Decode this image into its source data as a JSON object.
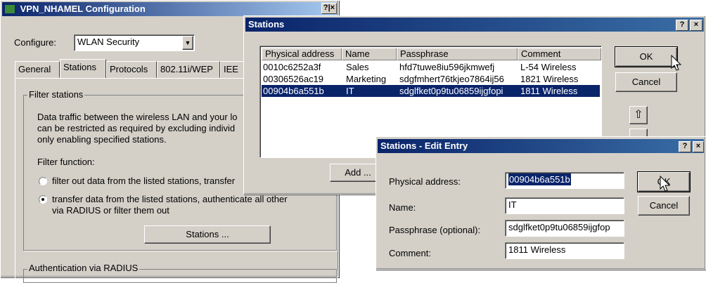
{
  "config_window": {
    "title": "VPN_NHAMEL Configuration",
    "help_close": "?|×",
    "configure_label": "Configure:",
    "configure_value": "WLAN Security",
    "tabs": [
      "General",
      "Stations",
      "Protocols",
      "802.11i/WEP",
      "IEE"
    ],
    "filter_group_title": "Filter stations",
    "filter_text_1": "Data traffic between the wireless LAN and your lo",
    "filter_text_2": "can be restricted as required by excluding individ",
    "filter_text_3": "only enabling specified stations.",
    "filter_function_label": "Filter function:",
    "radio_1_label": "filter out data from the listed stations, transfer",
    "radio_2_label_line1": "transfer data from the listed stations, authenticate all other",
    "radio_2_label_line2": "via RADIUS or filter them out",
    "stations_button": "Stations ...",
    "auth_group_title": "Authentication via RADIUS"
  },
  "stations_window": {
    "title": "Stations",
    "headers": [
      "Physical address",
      "Name",
      "Passphrase",
      "Comment"
    ],
    "rows": [
      [
        "0010c6252a3f",
        "Sales",
        "hfd7tuwe8iu596jkmwefj",
        "L-54 Wireless"
      ],
      [
        "00306526ac19",
        "Marketing",
        "sdgfmhert76tkjeo7864ij56",
        "1821 Wireless"
      ],
      [
        "00904b6a551b",
        "IT",
        "sdglfket0p9tu06859ijgfopi",
        "1811 Wireless"
      ]
    ],
    "selected_row": 2,
    "ok": "OK",
    "cancel": "Cancel",
    "add": "Add ...",
    "up_arrow": "⇧"
  },
  "edit_window": {
    "title": "Stations - Edit Entry",
    "physical_address_label": "Physical address:",
    "physical_address_value": "00904b6a551b",
    "name_label": "Name:",
    "name_value": "IT",
    "passphrase_label": "Passphrase (optional):",
    "passphrase_value": "sdglfket0p9tu06859ijgfop",
    "comment_label": "Comment:",
    "comment_value": "1811 Wireless",
    "ok": "OK",
    "cancel": "Cancel"
  },
  "colors": {
    "titlebar_active": "#0a246a",
    "selection": "#0a246a",
    "face": "#d4d0c8"
  }
}
